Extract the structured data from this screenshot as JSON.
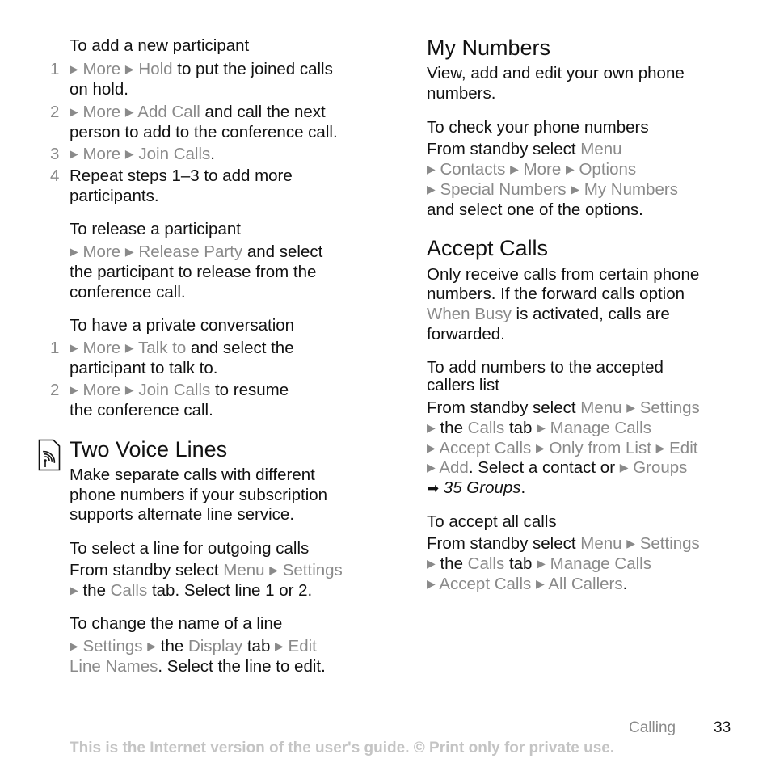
{
  "left": {
    "add_participant": {
      "heading": "To add a new participant",
      "steps": [
        {
          "n": "1",
          "l1a": "More",
          "l1b": "Hold",
          "l1c": " to put the joined calls",
          "l2": "on hold."
        },
        {
          "n": "2",
          "l1a": "More",
          "l1b": "Add Call",
          "l1c": " and call the next",
          "l2": "person to add to the conference call."
        },
        {
          "n": "3",
          "l1a": "More",
          "l1b": "Join Calls",
          "l1c": "."
        },
        {
          "n": "4",
          "l1": "Repeat steps 1–3 to add more",
          "l2": "participants."
        }
      ]
    },
    "release": {
      "heading": "To release a participant",
      "a": "More",
      "b": "Release Party",
      "c": " and select",
      "l2": "the participant to release from the",
      "l3": "conference call."
    },
    "private": {
      "heading": "To have a private conversation",
      "steps": [
        {
          "n": "1",
          "a": "More",
          "b": "Talk to",
          "c": " and select the",
          "l2": "participant to talk to."
        },
        {
          "n": "2",
          "a": "More",
          "b": "Join Calls",
          "c": " to resume",
          "l2": "the conference call."
        }
      ]
    },
    "two_lines": {
      "title": "Two Voice Lines",
      "icon": "network-service-icon",
      "body": [
        "Make separate calls with different",
        "phone numbers if your subscription",
        "supports alternate line service."
      ]
    },
    "select_line": {
      "heading": "To select a line for outgoing calls",
      "l1a": "From standby select ",
      "l1b": "Menu",
      "l1c": "Settings",
      "l2a": " the ",
      "l2b": "Calls",
      "l2c": " tab. Select line 1 or 2."
    },
    "change_name": {
      "heading": "To change the name of a line",
      "l1a": "Settings",
      "l1b": " the ",
      "l1c": "Display",
      "l1d": " tab ",
      "l1e": "Edit",
      "l2a": "Line Names",
      "l2b": ". Select the line to edit."
    }
  },
  "right": {
    "my_numbers": {
      "title": "My Numbers",
      "body": [
        "View, add and edit your own phone",
        "numbers."
      ],
      "heading": "To check your phone numbers",
      "l1a": "From standby select ",
      "l1b": "Menu",
      "l2": [
        "Contacts",
        "More",
        "Options"
      ],
      "l3": [
        "Special Numbers",
        "My Numbers"
      ],
      "l4": "and select one of the options."
    },
    "accept_calls": {
      "title": "Accept Calls",
      "body1": "Only receive calls from certain phone",
      "body2": "numbers. If the forward calls option",
      "body3a": "When Busy",
      "body3b": " is activated, calls are",
      "body4": "forwarded."
    },
    "add_numbers": {
      "heading1": "To add numbers to the accepted",
      "heading2": "callers list",
      "l1a": "From standby select ",
      "l1b": "Menu",
      "l1c": "Settings",
      "l2a": " the ",
      "l2b": "Calls",
      "l2c": " tab ",
      "l2d": "Manage Calls",
      "l3": [
        "Accept Calls",
        "Only from List",
        "Edit"
      ],
      "l4a": "Add",
      "l4b": ". Select a contact or ",
      "l4c": "Groups",
      "l5": "35 Groups",
      "l5b": "."
    },
    "accept_all": {
      "heading": "To accept all calls",
      "l1a": "From standby select ",
      "l1b": "Menu",
      "l1c": "Settings",
      "l2a": " the ",
      "l2b": "Calls",
      "l2c": " tab ",
      "l2d": "Manage Calls",
      "l3a": "Accept Calls",
      "l3b": "All Callers",
      "l3c": "."
    }
  },
  "footer": {
    "section": "Calling",
    "page": "33",
    "disclaimer": "This is the Internet version of the user's guide. © Print only for private use."
  }
}
